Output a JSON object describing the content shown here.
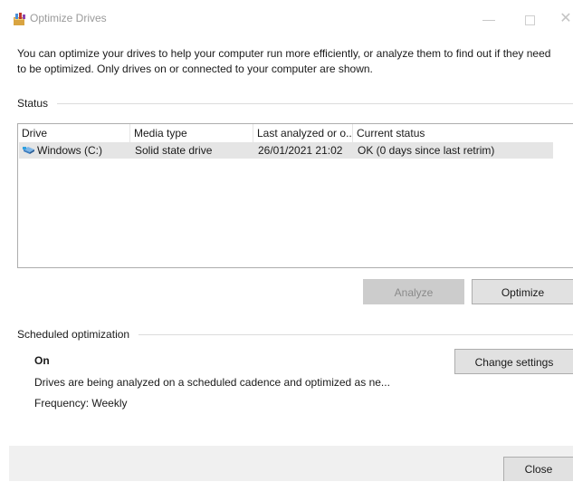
{
  "window": {
    "title": "Optimize Drives",
    "controls": {
      "minimize": "—",
      "close": "✕"
    }
  },
  "description": "You can optimize your drives to help your computer run more efficiently, or analyze them to find out if they need to be optimized. Only drives on or connected to your computer are shown.",
  "status": {
    "label": "Status",
    "columns": [
      "Drive",
      "Media type",
      "Last analyzed or o...",
      "Current status"
    ],
    "rows": [
      {
        "drive": "Windows (C:)",
        "media_type": "Solid state drive",
        "last_analyzed": "26/01/2021 21:02",
        "current_status": "OK (0 days since last retrim)",
        "selected": true
      }
    ]
  },
  "actions": {
    "analyze": "Analyze",
    "optimize": "Optimize"
  },
  "scheduled": {
    "label": "Scheduled optimization",
    "state": "On",
    "description": "Drives are being analyzed on a scheduled cadence and optimized as ne...",
    "frequency": "Frequency: Weekly",
    "change_settings": "Change settings"
  },
  "footer": {
    "close": "Close"
  },
  "colors": {
    "selected_row": "#e5e5e5",
    "button_bg": "#e1e1e1",
    "button_disabled_bg": "#cccccc",
    "footer_bg": "#f0f0f0"
  },
  "icons": {
    "app": "optimize-drives-app-icon",
    "drive": "drive-icon"
  }
}
